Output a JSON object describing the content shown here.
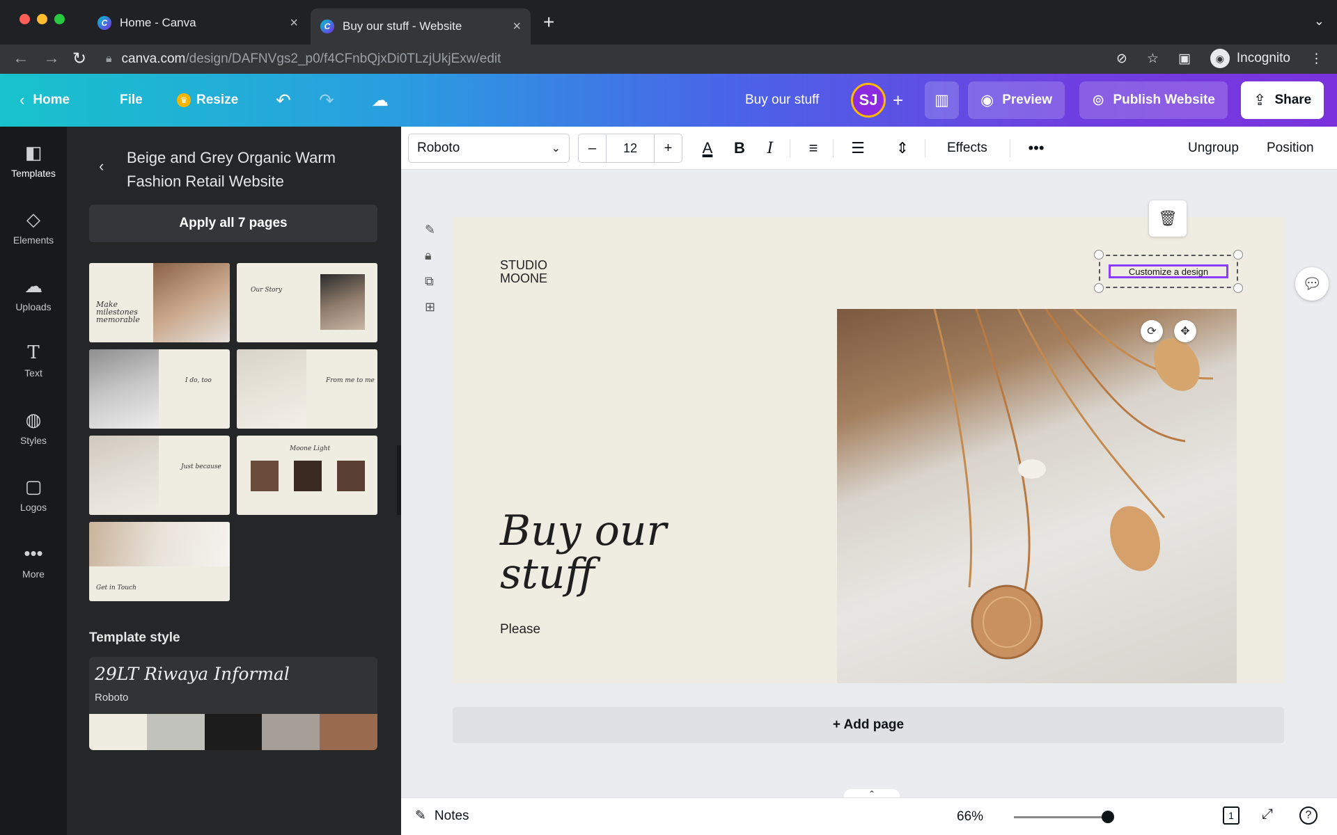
{
  "browser": {
    "tabs": [
      {
        "title": "Home - Canva",
        "active": false
      },
      {
        "title": "Buy our stuff - Website",
        "active": true
      }
    ],
    "url_host": "canva.com",
    "url_path": "/design/DAFNVgs2_p0/f4CFnbQjxDi0TLzjUkjExw/edit",
    "profile": "Incognito"
  },
  "topbar": {
    "home": "Home",
    "file": "File",
    "resize": "Resize",
    "design_name": "Buy our stuff",
    "avatar": "SJ",
    "preview": "Preview",
    "publish": "Publish Website",
    "share": "Share"
  },
  "rail": [
    "Templates",
    "Elements",
    "Uploads",
    "Text",
    "Styles",
    "Logos",
    "More"
  ],
  "panel": {
    "title": "Beige and Grey Organic Warm Fashion Retail Website",
    "apply": "Apply all 7 pages",
    "thumbs": [
      "Make milestones memorable",
      "Our Story",
      "I do, too",
      "From me to me",
      "Just because",
      "Moone Light",
      "Get in Touch"
    ],
    "style_heading": "Template style",
    "font_primary": "29LT Riwaya Informal",
    "font_secondary": "Roboto",
    "swatches": [
      "#efede1",
      "#c2c2bd",
      "#1c1c1c",
      "#a59f98",
      "#9a6a4e"
    ]
  },
  "toolbar": {
    "font": "Roboto",
    "size": "12",
    "effects": "Effects",
    "ungroup": "Ungroup",
    "position": "Position"
  },
  "canvas": {
    "logo_line1": "STUDIO",
    "logo_line2": "MOONE",
    "headline": "Buy our stuff",
    "subtext": "Please",
    "selected_text": "Customize a design",
    "add_page": "+ Add page"
  },
  "bottom": {
    "notes": "Notes",
    "zoom": "66%",
    "zoom_level": 0.66,
    "page_count": "1"
  }
}
